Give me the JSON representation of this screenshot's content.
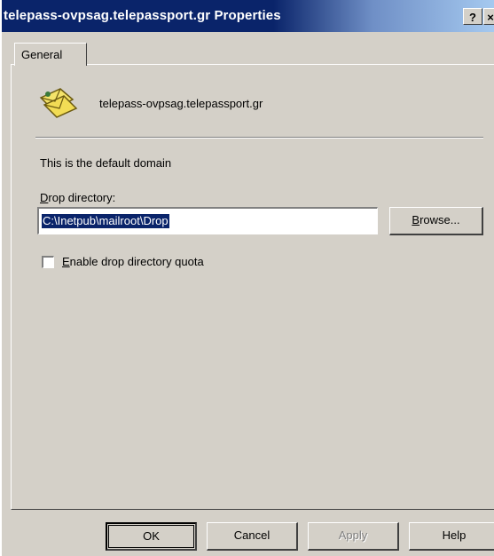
{
  "window": {
    "title": "telepass-ovpsag.telepassport.gr Properties",
    "help_button": "?",
    "close_button": "×"
  },
  "tabs": [
    {
      "label": "General",
      "selected": true
    }
  ],
  "general": {
    "domain_icon": "domain-envelope-icon",
    "domain_name": "telepass-ovpsag.telepassport.gr",
    "default_domain_text": "This is the default domain",
    "drop_directory": {
      "label_accel": "D",
      "label_rest": "rop directory:",
      "value": "C:\\Inetpub\\mailroot\\Drop",
      "browse_accel": "B",
      "browse_rest": "rowse..."
    },
    "quota": {
      "checked": false,
      "label_accel": "E",
      "label_rest": "nable drop directory quota"
    }
  },
  "footer": {
    "ok": "OK",
    "cancel": "Cancel",
    "apply": "Apply",
    "help": "Help"
  },
  "colors": {
    "titlebar": "#0a246a",
    "selection": "#0a246a",
    "face": "#d4d0c8"
  }
}
